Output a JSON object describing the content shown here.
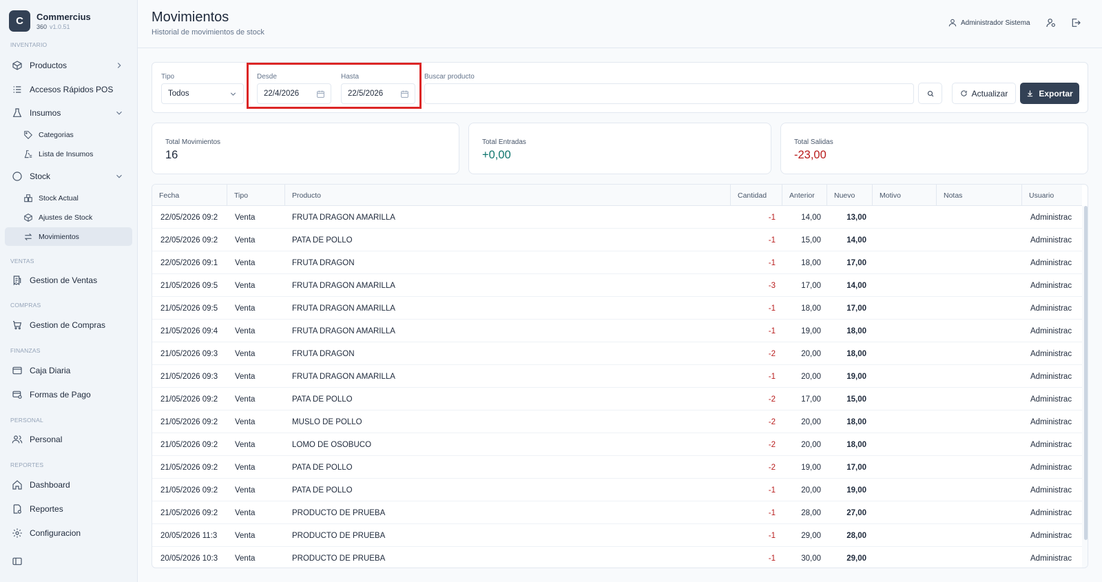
{
  "app": {
    "logo_letter": "C",
    "name": "Commercius",
    "sub": "360",
    "version": "v1.0.51"
  },
  "sidebar": {
    "sections": {
      "inventario": "INVENTARIO",
      "ventas": "VENTAS",
      "compras": "COMPRAS",
      "finanzas": "FINANZAS",
      "personal": "PERSONAL",
      "reportes": "REPORTES"
    },
    "items": {
      "productos": "Productos",
      "accesos": "Accesos Rápidos POS",
      "insumos": "Insumos",
      "categorias": "Categorias",
      "lista_insumos": "Lista de Insumos",
      "stock": "Stock",
      "stock_actual": "Stock Actual",
      "ajustes": "Ajustes de Stock",
      "movimientos": "Movimientos",
      "ventas": "Gestion de Ventas",
      "compras": "Gestion de Compras",
      "caja": "Caja Diaria",
      "formas_pago": "Formas de Pago",
      "personal": "Personal",
      "dashboard": "Dashboard",
      "reportes": "Reportes",
      "configuracion": "Configuracion"
    }
  },
  "header": {
    "title": "Movimientos",
    "subtitle": "Historial de movimientos de stock",
    "user": "Administrador Sistema"
  },
  "filters": {
    "tipo_label": "Tipo",
    "tipo_value": "Todos",
    "desde_label": "Desde",
    "desde_value": "22/4/2026",
    "hasta_label": "Hasta",
    "hasta_value": "22/5/2026",
    "buscar_label": "Buscar producto",
    "buscar_value": "",
    "actualizar": "Actualizar",
    "exportar": "Exportar"
  },
  "stats": {
    "total_mov_label": "Total Movimientos",
    "total_mov": "16",
    "entradas_label": "Total Entradas",
    "entradas": "+0,00",
    "salidas_label": "Total Salidas",
    "salidas": "-23,00"
  },
  "colors": {
    "accent": "#334155",
    "positive": "#0f766e",
    "negative": "#b91c1c",
    "highlight": "#dc2626"
  },
  "table": {
    "headers": {
      "fecha": "Fecha",
      "tipo": "Tipo",
      "producto": "Producto",
      "cantidad": "Cantidad",
      "anterior": "Anterior",
      "nuevo": "Nuevo",
      "motivo": "Motivo",
      "notas": "Notas",
      "usuario": "Usuario"
    },
    "rows": [
      {
        "fecha": "22/05/2026 09:2",
        "tipo": "Venta",
        "producto": "FRUTA DRAGON AMARILLA",
        "cantidad": "-1",
        "anterior": "14,00",
        "nuevo": "13,00",
        "motivo": "",
        "notas": "",
        "usuario": "Administrac"
      },
      {
        "fecha": "22/05/2026 09:2",
        "tipo": "Venta",
        "producto": "PATA DE POLLO",
        "cantidad": "-1",
        "anterior": "15,00",
        "nuevo": "14,00",
        "motivo": "",
        "notas": "",
        "usuario": "Administrac"
      },
      {
        "fecha": "22/05/2026 09:1",
        "tipo": "Venta",
        "producto": "FRUTA DRAGON",
        "cantidad": "-1",
        "anterior": "18,00",
        "nuevo": "17,00",
        "motivo": "",
        "notas": "",
        "usuario": "Administrac"
      },
      {
        "fecha": "21/05/2026 09:5",
        "tipo": "Venta",
        "producto": "FRUTA DRAGON AMARILLA",
        "cantidad": "-3",
        "anterior": "17,00",
        "nuevo": "14,00",
        "motivo": "",
        "notas": "",
        "usuario": "Administrac"
      },
      {
        "fecha": "21/05/2026 09:5",
        "tipo": "Venta",
        "producto": "FRUTA DRAGON AMARILLA",
        "cantidad": "-1",
        "anterior": "18,00",
        "nuevo": "17,00",
        "motivo": "",
        "notas": "",
        "usuario": "Administrac"
      },
      {
        "fecha": "21/05/2026 09:4",
        "tipo": "Venta",
        "producto": "FRUTA DRAGON AMARILLA",
        "cantidad": "-1",
        "anterior": "19,00",
        "nuevo": "18,00",
        "motivo": "",
        "notas": "",
        "usuario": "Administrac"
      },
      {
        "fecha": "21/05/2026 09:3",
        "tipo": "Venta",
        "producto": "FRUTA DRAGON",
        "cantidad": "-2",
        "anterior": "20,00",
        "nuevo": "18,00",
        "motivo": "",
        "notas": "",
        "usuario": "Administrac"
      },
      {
        "fecha": "21/05/2026 09:3",
        "tipo": "Venta",
        "producto": "FRUTA DRAGON AMARILLA",
        "cantidad": "-1",
        "anterior": "20,00",
        "nuevo": "19,00",
        "motivo": "",
        "notas": "",
        "usuario": "Administrac"
      },
      {
        "fecha": "21/05/2026 09:2",
        "tipo": "Venta",
        "producto": "PATA DE POLLO",
        "cantidad": "-2",
        "anterior": "17,00",
        "nuevo": "15,00",
        "motivo": "",
        "notas": "",
        "usuario": "Administrac"
      },
      {
        "fecha": "21/05/2026 09:2",
        "tipo": "Venta",
        "producto": "MUSLO DE POLLO",
        "cantidad": "-2",
        "anterior": "20,00",
        "nuevo": "18,00",
        "motivo": "",
        "notas": "",
        "usuario": "Administrac"
      },
      {
        "fecha": "21/05/2026 09:2",
        "tipo": "Venta",
        "producto": "LOMO DE OSOBUCO",
        "cantidad": "-2",
        "anterior": "20,00",
        "nuevo": "18,00",
        "motivo": "",
        "notas": "",
        "usuario": "Administrac"
      },
      {
        "fecha": "21/05/2026 09:2",
        "tipo": "Venta",
        "producto": "PATA DE POLLO",
        "cantidad": "-2",
        "anterior": "19,00",
        "nuevo": "17,00",
        "motivo": "",
        "notas": "",
        "usuario": "Administrac"
      },
      {
        "fecha": "21/05/2026 09:2",
        "tipo": "Venta",
        "producto": "PATA DE POLLO",
        "cantidad": "-1",
        "anterior": "20,00",
        "nuevo": "19,00",
        "motivo": "",
        "notas": "",
        "usuario": "Administrac"
      },
      {
        "fecha": "21/05/2026 09:2",
        "tipo": "Venta",
        "producto": "PRODUCTO DE PRUEBA",
        "cantidad": "-1",
        "anterior": "28,00",
        "nuevo": "27,00",
        "motivo": "",
        "notas": "",
        "usuario": "Administrac"
      },
      {
        "fecha": "20/05/2026 11:3",
        "tipo": "Venta",
        "producto": "PRODUCTO DE PRUEBA",
        "cantidad": "-1",
        "anterior": "29,00",
        "nuevo": "28,00",
        "motivo": "",
        "notas": "",
        "usuario": "Administrac"
      },
      {
        "fecha": "20/05/2026 10:3",
        "tipo": "Venta",
        "producto": "PRODUCTO DE PRUEBA",
        "cantidad": "-1",
        "anterior": "30,00",
        "nuevo": "29,00",
        "motivo": "",
        "notas": "",
        "usuario": "Administrac"
      }
    ]
  }
}
